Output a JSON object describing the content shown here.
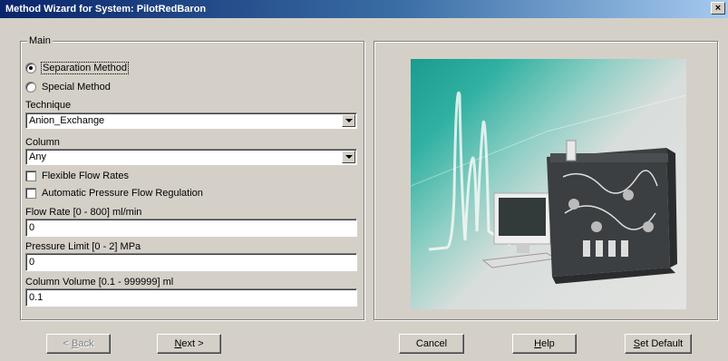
{
  "window": {
    "title": "Method Wizard for System: PilotRedBaron",
    "close_label": "×"
  },
  "main_group": {
    "legend": "Main",
    "method_options": [
      {
        "label": "Separation Method",
        "selected": true
      },
      {
        "label": "Special Method",
        "selected": false
      }
    ],
    "technique": {
      "label": "Technique",
      "value": "Anion_Exchange"
    },
    "column": {
      "label": "Column",
      "value": "Any"
    },
    "checkboxes": [
      {
        "label": "Flexible Flow Rates",
        "checked": false
      },
      {
        "label": "Automatic Pressure Flow Regulation",
        "checked": false
      }
    ],
    "flow_rate": {
      "label": "Flow Rate [0 - 800] ml/min",
      "value": "0"
    },
    "pressure_limit": {
      "label": "Pressure Limit [0 - 2] MPa",
      "value": "0"
    },
    "column_volume": {
      "label": "Column Volume [0.1 - 999999] ml",
      "value": "0.1"
    }
  },
  "buttons": {
    "back": {
      "mnemonic": "B",
      "rest": "ack",
      "prefix": "< "
    },
    "next": {
      "mnemonic": "N",
      "rest": "ext >"
    },
    "cancel": {
      "label": "Cancel"
    },
    "help": {
      "mnemonic": "H",
      "rest": "elp"
    },
    "set_default": {
      "mnemonic": "S",
      "rest": "et Default"
    }
  },
  "colors": {
    "titlebar_start": "#0a246a",
    "titlebar_end": "#a6caf0",
    "dialog_face": "#d4d0c8",
    "photo_teal": "#1c9a8f"
  }
}
